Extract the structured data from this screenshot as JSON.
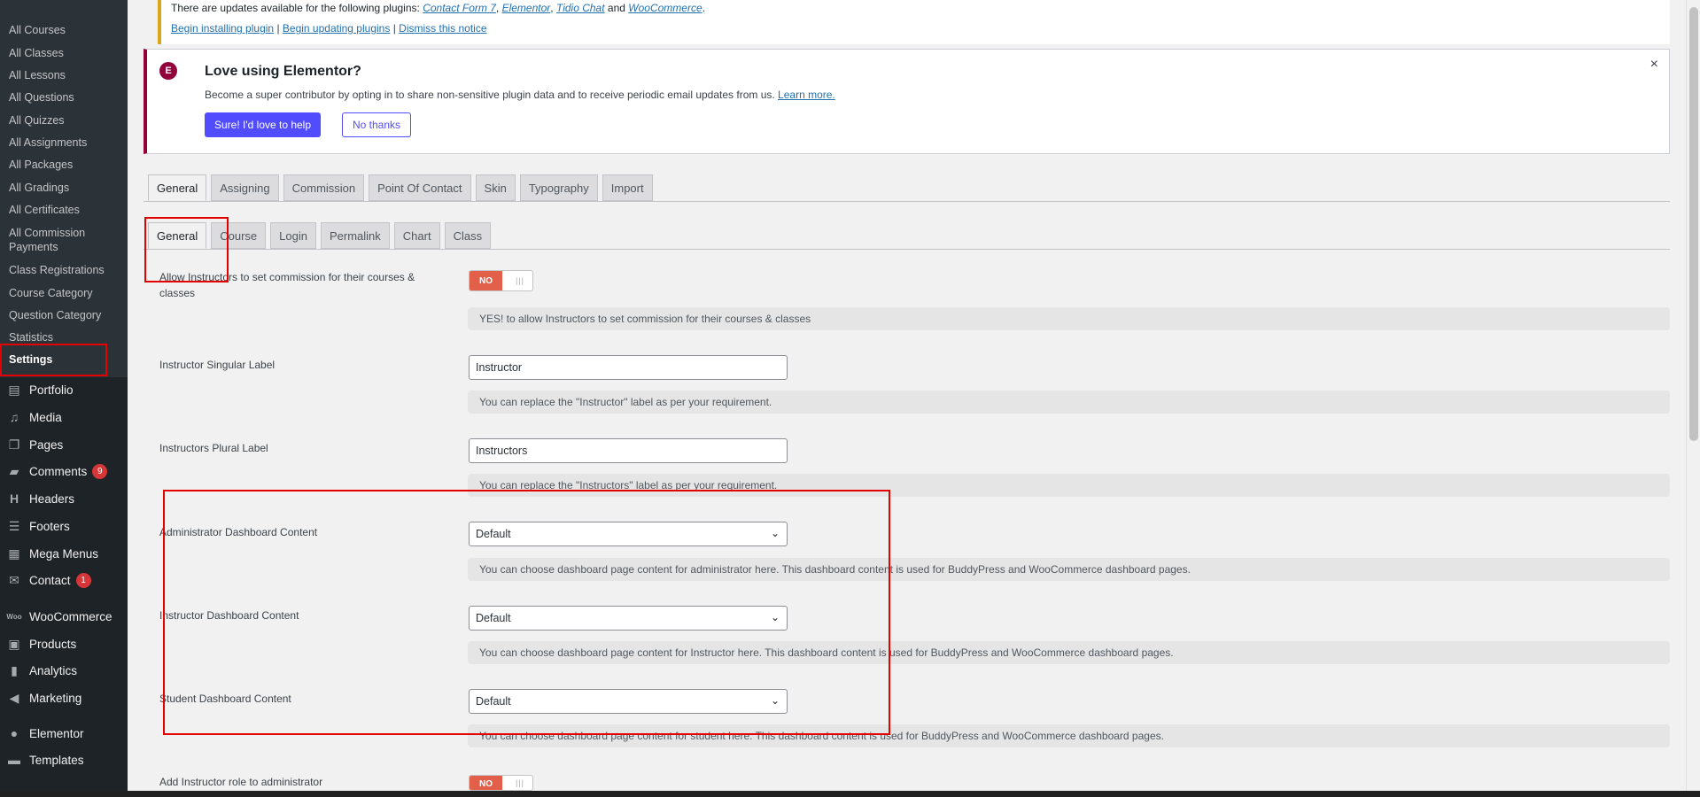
{
  "sidebar": {
    "submenu": [
      {
        "label": "All Courses"
      },
      {
        "label": "All Classes"
      },
      {
        "label": "All Lessons"
      },
      {
        "label": "All Questions"
      },
      {
        "label": "All Quizzes"
      },
      {
        "label": "All Assignments"
      },
      {
        "label": "All Packages"
      },
      {
        "label": "All Gradings"
      },
      {
        "label": "All Certificates"
      },
      {
        "label": "All Commission Payments"
      },
      {
        "label": "Class Registrations"
      },
      {
        "label": "Course Category"
      },
      {
        "label": "Question Category"
      },
      {
        "label": "Statistics"
      },
      {
        "label": "Settings"
      }
    ],
    "menu": [
      {
        "label": "Portfolio",
        "icon": "portfolio-icon"
      },
      {
        "label": "Media",
        "icon": "media-icon"
      },
      {
        "label": "Pages",
        "icon": "pages-icon"
      },
      {
        "label": "Comments",
        "icon": "comments-icon",
        "badge": "9"
      },
      {
        "label": "Headers",
        "icon": "headers-icon"
      },
      {
        "label": "Footers",
        "icon": "footers-icon"
      },
      {
        "label": "Mega Menus",
        "icon": "mega-menus-icon"
      },
      {
        "label": "Contact",
        "icon": "contact-icon",
        "badge": "1"
      },
      {
        "label": "WooCommerce",
        "icon": "woocommerce-icon"
      },
      {
        "label": "Products",
        "icon": "products-icon"
      },
      {
        "label": "Analytics",
        "icon": "analytics-icon"
      },
      {
        "label": "Marketing",
        "icon": "marketing-icon"
      },
      {
        "label": "Elementor",
        "icon": "elementor-icon"
      },
      {
        "label": "Templates",
        "icon": "templates-icon"
      }
    ]
  },
  "update_notice": {
    "prefix": "There are updates available for the following plugins:",
    "plugins": [
      "Contact Form 7",
      "Elementor",
      "Tidio Chat",
      "WooCommerce"
    ],
    "sep1": ",",
    "and": "and",
    "end": ".",
    "actions": [
      "Begin installing plugin",
      "Begin updating plugins",
      "Dismiss this notice"
    ],
    "divider": "|"
  },
  "elementor_notice": {
    "logo": "E",
    "title": "Love using Elementor?",
    "description": "Become a super contributor by opting in to share non-sensitive plugin data and to receive periodic email updates from us.",
    "learn_more": "Learn more.",
    "primary_button": "Sure! I'd love to help",
    "secondary_button": "No thanks",
    "close": "×"
  },
  "primary_tabs": [
    "General",
    "Assigning",
    "Commission",
    "Point Of Contact",
    "Skin",
    "Typography",
    "Import"
  ],
  "secondary_tabs": [
    "General",
    "Course",
    "Login",
    "Permalink",
    "Chart",
    "Class"
  ],
  "settings": {
    "commission": {
      "label": "Allow Instructors to set commission for their courses & classes",
      "toggle": "NO",
      "description": "YES! to allow Instructors to set commission for their courses & classes"
    },
    "singular": {
      "label": "Instructor Singular Label",
      "value": "Instructor",
      "description": "You can replace the \"Instructor\" label as per your requirement."
    },
    "plural": {
      "label": "Instructors Plural Label",
      "value": "Instructors",
      "description": "You can replace the \"Instructors\" label as per your requirement."
    },
    "admin_dashboard": {
      "label": "Administrator Dashboard Content",
      "value": "Default",
      "description": "You can choose dashboard page content for administrator here. This dashboard content is used for BuddyPress and WooCommerce dashboard pages."
    },
    "instructor_dashboard": {
      "label": "Instructor Dashboard Content",
      "value": "Default",
      "description": "You can choose dashboard page content for Instructor here. This dashboard content is used for BuddyPress and WooCommerce dashboard pages."
    },
    "student_dashboard": {
      "label": "Student Dashboard Content",
      "value": "Default",
      "description": "You can choose dashboard page content for student here. This dashboard content is used for BuddyPress and WooCommerce dashboard pages."
    },
    "admin_role": {
      "label": "Add Instructor role to administrator",
      "toggle": "NO"
    }
  },
  "colors": {
    "sidebar_bg": "#1d2327",
    "submenu_bg": "#2c3338",
    "elementor_accent": "#92003b",
    "elementor_button": "#524cff",
    "toggle_off": "#e2604a",
    "highlight": "#e50000"
  }
}
